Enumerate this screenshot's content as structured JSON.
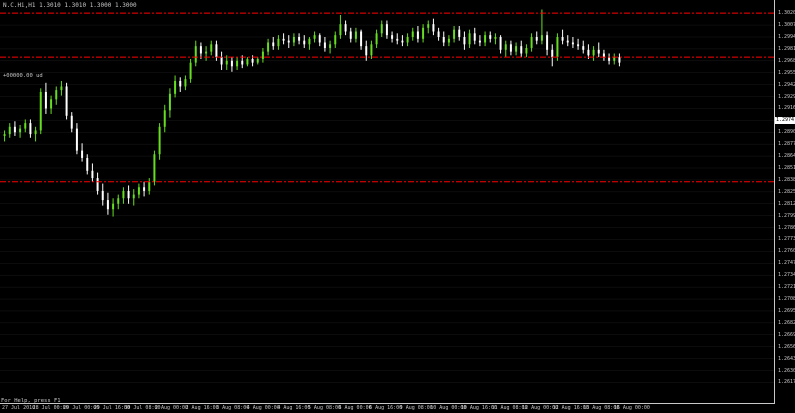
{
  "chart": {
    "symbol_header": "N.C.Hi,H1 1.3010 1.3010 1.3000 1.3000",
    "level_tag": "+00000.00 ud",
    "status_label": "For Help, press F1",
    "bid_label": "1.2974"
  },
  "colors": {
    "background": "#000000",
    "bull_candle": "#66dd22",
    "bear_candle": "#ffffff",
    "level_line": "#ff0000",
    "grid": "#1a1a1a",
    "scale_text": "#c8c8c8"
  },
  "chart_data": {
    "type": "candlestick",
    "grid": true,
    "ylim": [
      1.26,
      1.303
    ],
    "price_ticks": [
      "1.3020",
      "1.3007",
      "1.2994",
      "1.2981",
      "1.2968",
      "1.2955",
      "1.2942",
      "1.2929",
      "1.2916",
      "1.2903",
      "1.2890",
      "1.2877",
      "1.2864",
      "1.2851",
      "1.2838",
      "1.2825",
      "1.2812",
      "1.2799",
      "1.2786",
      "1.2773",
      "1.2760",
      "1.2747",
      "1.2734",
      "1.2721",
      "1.2708",
      "1.2695",
      "1.2682",
      "1.2669",
      "1.2656",
      "1.2643",
      "1.2630",
      "1.2617"
    ],
    "time_labels": [
      "27 Jul 2010",
      "28 Jul 00:00",
      "29 Jul 00:00",
      "29 Jul 16:00",
      "30 Jul 08:00",
      "2 Aug 00:00",
      "2 Aug 16:00",
      "3 Aug 08:00",
      "4 Aug 00:00",
      "4 Aug 16:00",
      "5 Aug 08:00",
      "6 Aug 00:00",
      "6 Aug 16:00",
      "9 Aug 08:00",
      "10 Aug 00:00",
      "10 Aug 16:00",
      "11 Aug 08:00",
      "12 Aug 00:00",
      "12 Aug 16:00",
      "13 Aug 08:00",
      "16 Aug 00:00"
    ],
    "levels": [
      1.302,
      1.2972,
      1.2836
    ],
    "candles": [
      [
        1.2886,
        1.2892,
        1.288,
        1.2888
      ],
      [
        1.2888,
        1.29,
        1.2884,
        1.2896
      ],
      [
        1.2896,
        1.2902,
        1.2886,
        1.289
      ],
      [
        1.289,
        1.2898,
        1.2884,
        1.2894
      ],
      [
        1.2894,
        1.2904,
        1.289,
        1.29
      ],
      [
        1.29,
        1.2904,
        1.2884,
        1.2888
      ],
      [
        1.2888,
        1.2896,
        1.288,
        1.2892
      ],
      [
        1.2892,
        1.2938,
        1.2888,
        1.2934
      ],
      [
        1.2934,
        1.2944,
        1.291,
        1.2916
      ],
      [
        1.2916,
        1.293,
        1.291,
        1.2926
      ],
      [
        1.2926,
        1.294,
        1.292,
        1.2936
      ],
      [
        1.2936,
        1.2946,
        1.293,
        1.294
      ],
      [
        1.294,
        1.2944,
        1.2904,
        1.2908
      ],
      [
        1.2908,
        1.2912,
        1.289,
        1.2894
      ],
      [
        1.2894,
        1.29,
        1.2866,
        1.287
      ],
      [
        1.287,
        1.2878,
        1.2858,
        1.2862
      ],
      [
        1.2862,
        1.2866,
        1.2844,
        1.2848
      ],
      [
        1.2848,
        1.2856,
        1.2836,
        1.284
      ],
      [
        1.284,
        1.2846,
        1.2822,
        1.2826
      ],
      [
        1.2826,
        1.2834,
        1.281,
        1.2816
      ],
      [
        1.2816,
        1.2824,
        1.28,
        1.2806
      ],
      [
        1.2806,
        1.2818,
        1.2798,
        1.2812
      ],
      [
        1.2812,
        1.2822,
        1.2806,
        1.2818
      ],
      [
        1.2818,
        1.283,
        1.2812,
        1.2826
      ],
      [
        1.2826,
        1.2832,
        1.2812,
        1.2818
      ],
      [
        1.2818,
        1.2828,
        1.281,
        1.2822
      ],
      [
        1.2822,
        1.2834,
        1.2818,
        1.283
      ],
      [
        1.283,
        1.2836,
        1.282,
        1.2826
      ],
      [
        1.2826,
        1.284,
        1.2822,
        1.2836
      ],
      [
        1.2836,
        1.287,
        1.2832,
        1.2866
      ],
      [
        1.2866,
        1.29,
        1.286,
        1.2896
      ],
      [
        1.2896,
        1.292,
        1.289,
        1.2914
      ],
      [
        1.2914,
        1.2938,
        1.2906,
        1.2932
      ],
      [
        1.2932,
        1.2952,
        1.2928,
        1.2946
      ],
      [
        1.2946,
        1.295,
        1.2934,
        1.294
      ],
      [
        1.294,
        1.2952,
        1.2936,
        1.2948
      ],
      [
        1.2948,
        1.297,
        1.2944,
        1.2966
      ],
      [
        1.2966,
        1.299,
        1.2962,
        1.2984
      ],
      [
        1.2984,
        1.2988,
        1.297,
        1.2976
      ],
      [
        1.2976,
        1.2984,
        1.2968,
        1.2978
      ],
      [
        1.2978,
        1.299,
        1.2974,
        1.2986
      ],
      [
        1.2986,
        1.299,
        1.2968,
        1.2972
      ],
      [
        1.2972,
        1.2978,
        1.2958,
        1.2964
      ],
      [
        1.2964,
        1.2974,
        1.2958,
        1.2968
      ],
      [
        1.2968,
        1.2972,
        1.2956,
        1.2962
      ],
      [
        1.2962,
        1.2972,
        1.2958,
        1.2968
      ],
      [
        1.2968,
        1.2974,
        1.296,
        1.2964
      ],
      [
        1.2964,
        1.2972,
        1.2962,
        1.297
      ],
      [
        1.297,
        1.2974,
        1.2962,
        1.2966
      ],
      [
        1.2966,
        1.2972,
        1.2964,
        1.297
      ],
      [
        1.297,
        1.2982,
        1.2966,
        1.2978
      ],
      [
        1.2978,
        1.2992,
        1.2974,
        1.2988
      ],
      [
        1.2988,
        1.2994,
        1.298,
        1.2984
      ],
      [
        1.2984,
        1.2996,
        1.298,
        1.2992
      ],
      [
        1.2992,
        1.2998,
        1.2986,
        1.299
      ],
      [
        1.299,
        1.2996,
        1.2982,
        1.2988
      ],
      [
        1.2988,
        1.2998,
        1.2984,
        1.2994
      ],
      [
        1.2994,
        1.2998,
        1.2986,
        1.299
      ],
      [
        1.299,
        1.2996,
        1.2982,
        1.2986
      ],
      [
        1.2986,
        1.2994,
        1.298,
        1.2992
      ],
      [
        1.2992,
        1.3,
        1.2988,
        1.2996
      ],
      [
        1.2996,
        1.2998,
        1.2984,
        1.2988
      ],
      [
        1.2988,
        1.2994,
        1.2978,
        1.2982
      ],
      [
        1.2982,
        1.299,
        1.2976,
        1.2986
      ],
      [
        1.2986,
        1.3,
        1.2982,
        1.2996
      ],
      [
        1.2996,
        1.3018,
        1.2992,
        1.3008
      ],
      [
        1.3008,
        1.3012,
        1.2996,
        1.3
      ],
      [
        1.3,
        1.3004,
        1.2988,
        1.2992
      ],
      [
        1.2992,
        1.3004,
        1.2988,
        1.3
      ],
      [
        1.3,
        1.3002,
        1.298,
        1.2984
      ],
      [
        1.2984,
        1.299,
        1.2968,
        1.2974
      ],
      [
        1.2974,
        1.299,
        1.297,
        1.2986
      ],
      [
        1.2986,
        1.3002,
        1.2982,
        1.2998
      ],
      [
        1.2998,
        1.3012,
        1.2994,
        1.3008
      ],
      [
        1.3008,
        1.3012,
        1.2992,
        1.2996
      ],
      [
        1.2996,
        1.3,
        1.2988,
        1.2992
      ],
      [
        1.2992,
        1.2998,
        1.2986,
        1.299
      ],
      [
        1.299,
        1.2996,
        1.2984,
        1.2988
      ],
      [
        1.2988,
        1.2998,
        1.2984,
        1.2994
      ],
      [
        1.2994,
        1.3004,
        1.299,
        1.3
      ],
      [
        1.3,
        1.3006,
        1.2988,
        1.2992
      ],
      [
        1.2992,
        1.3008,
        1.2988,
        1.3004
      ],
      [
        1.3004,
        1.3012,
        1.2998,
        1.3008
      ],
      [
        1.3008,
        1.3014,
        1.2996,
        1.3
      ],
      [
        1.3,
        1.3004,
        1.299,
        1.2994
      ],
      [
        1.2994,
        1.3,
        1.2984,
        1.2988
      ],
      [
        1.2988,
        1.2996,
        1.2984,
        1.2992
      ],
      [
        1.2992,
        1.3006,
        1.2988,
        1.3002
      ],
      [
        1.3002,
        1.3006,
        1.299,
        1.2994
      ],
      [
        1.2994,
        1.3,
        1.298,
        1.2986
      ],
      [
        1.2986,
        1.3002,
        1.2982,
        1.2998
      ],
      [
        1.2998,
        1.3004,
        1.2986,
        1.299
      ],
      [
        1.299,
        1.2996,
        1.2984,
        1.2988
      ],
      [
        1.2988,
        1.3,
        1.2984,
        1.2996
      ],
      [
        1.2996,
        1.3,
        1.2988,
        1.2992
      ],
      [
        1.2992,
        1.2998,
        1.2986,
        1.2994
      ],
      [
        1.2994,
        1.2996,
        1.2976,
        1.298
      ],
      [
        1.298,
        1.299,
        1.2972,
        1.2986
      ],
      [
        1.2986,
        1.299,
        1.2974,
        1.2978
      ],
      [
        1.2978,
        1.2988,
        1.2974,
        1.2984
      ],
      [
        1.2984,
        1.299,
        1.2972,
        1.2976
      ],
      [
        1.2976,
        1.2986,
        1.2972,
        1.2982
      ],
      [
        1.2982,
        1.2998,
        1.2978,
        1.2994
      ],
      [
        1.2994,
        1.3,
        1.2986,
        1.299
      ],
      [
        1.299,
        1.3024,
        1.2986,
        1.2996
      ],
      [
        1.2996,
        1.3,
        1.2974,
        1.298
      ],
      [
        1.298,
        1.2986,
        1.2962,
        1.2972
      ],
      [
        1.2972,
        1.2998,
        1.2968,
        1.2994
      ],
      [
        1.2994,
        1.3002,
        1.2986,
        1.299
      ],
      [
        1.299,
        1.2996,
        1.2984,
        1.2988
      ],
      [
        1.2988,
        1.2994,
        1.2982,
        1.2986
      ],
      [
        1.2986,
        1.2992,
        1.298,
        1.2984
      ],
      [
        1.2984,
        1.299,
        1.2976,
        1.298
      ],
      [
        1.298,
        1.2986,
        1.297,
        1.2974
      ],
      [
        1.2974,
        1.2984,
        1.2968,
        1.298
      ],
      [
        1.298,
        1.2988,
        1.2972,
        1.2976
      ],
      [
        1.2976,
        1.298,
        1.2968,
        1.2972
      ],
      [
        1.2972,
        1.2976,
        1.2964,
        1.2968
      ],
      [
        1.2968,
        1.2976,
        1.2964,
        1.2972
      ],
      [
        1.2972,
        1.2976,
        1.2962,
        1.2966
      ]
    ]
  }
}
